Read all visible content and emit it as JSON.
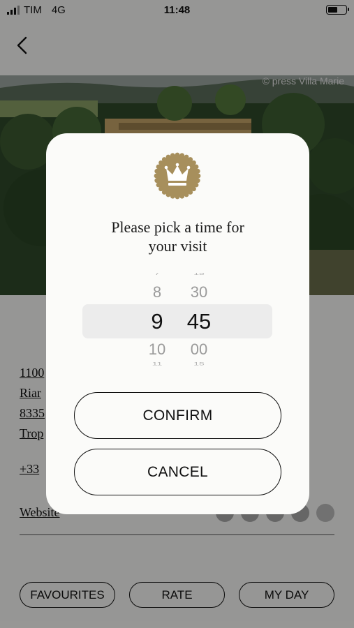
{
  "status_bar": {
    "carrier": "TIM",
    "network": "4G",
    "time": "11:48"
  },
  "hero": {
    "credit": "© press Villa Marie"
  },
  "address_lines": [
    "1100",
    "Riar",
    "8335",
    "Trop"
  ],
  "phone": "+33",
  "website_label": "Website",
  "rating": {
    "value_label": "4 of 5 crowns",
    "filled": 4,
    "total": 5
  },
  "bottom_bar": {
    "favourites": "FAVOURITES",
    "rate": "RATE",
    "my_day": "MY DAY"
  },
  "dialog": {
    "title_line1": "Please pick a time for",
    "title_line2": "your visit",
    "picker": {
      "hours": {
        "far_top": "7",
        "near_top": "8",
        "selected": "9",
        "near_bottom": "10",
        "far_bottom": "11"
      },
      "minutes": {
        "far_top": "15",
        "near_top": "30",
        "selected": "45",
        "near_bottom": "00",
        "far_bottom": "15"
      }
    },
    "confirm": "CONFIRM",
    "cancel": "CANCEL"
  },
  "colors": {
    "seal_gold": "#a78f5c",
    "overlay": "rgba(0,0,0,0.40)"
  }
}
